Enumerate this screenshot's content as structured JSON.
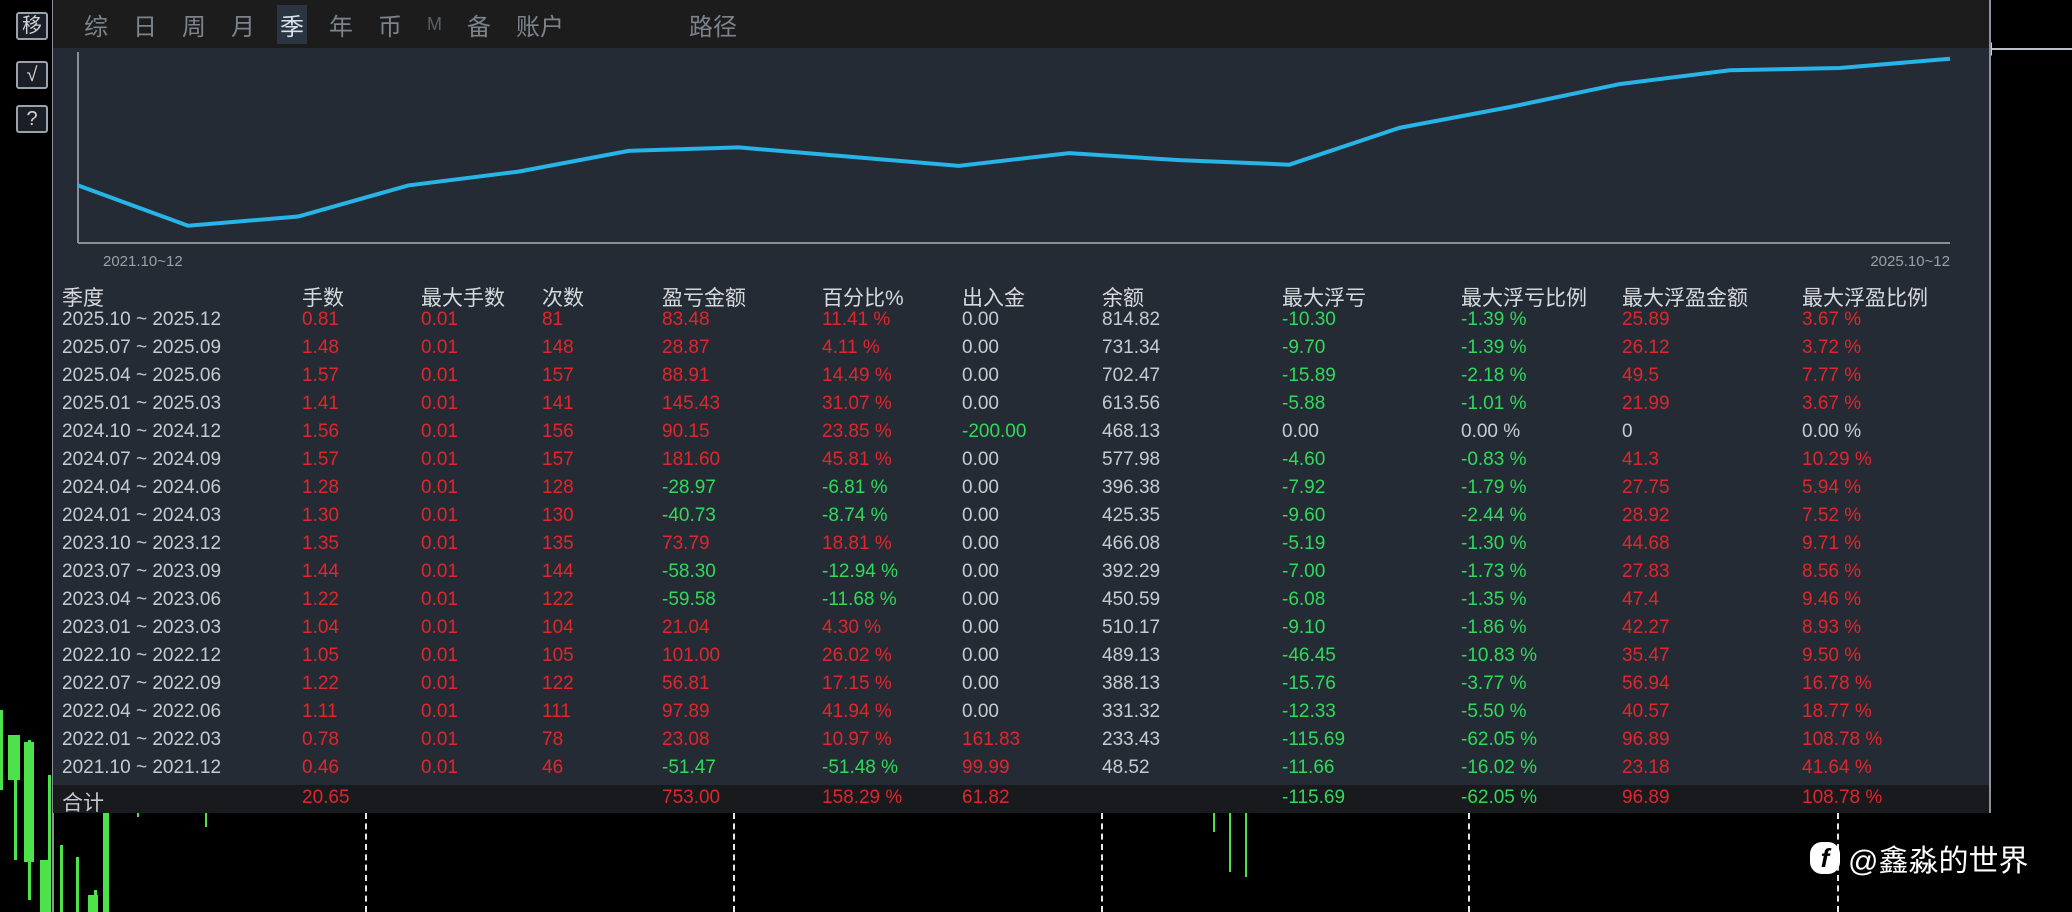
{
  "toolbar": {
    "move": "移",
    "check": "√",
    "help": "?"
  },
  "tabs": [
    {
      "label": "综"
    },
    {
      "label": "日"
    },
    {
      "label": "周"
    },
    {
      "label": "月"
    },
    {
      "label": "季",
      "active": true
    },
    {
      "label": "年"
    },
    {
      "label": "币"
    },
    {
      "label": "M"
    },
    {
      "label": "备"
    },
    {
      "label": "账户"
    },
    {
      "label": "路径"
    }
  ],
  "chart_data": {
    "type": "line",
    "x_start_label": "2021.10~12",
    "x_end_label": "2025.10~12",
    "series": [
      {
        "name": "equity",
        "values": [
          50,
          15,
          23,
          50,
          62,
          80,
          83,
          75,
          67,
          78,
          72,
          68,
          100,
          118,
          138,
          150,
          152,
          160
        ]
      }
    ],
    "colors": {
      "line": "#27b4e8"
    }
  },
  "table": {
    "headers": [
      "季度",
      "手数",
      "最大手数",
      "次数",
      "盈亏金额",
      "百分比%",
      "出入金",
      "余额",
      "最大浮亏",
      "最大浮亏比例",
      "最大浮盈金额",
      "最大浮盈比例"
    ],
    "rows": [
      [
        "2025.10 ~ 2025.12",
        "0.81",
        "0.01",
        "81",
        "83.48",
        "11.41 %",
        "0.00",
        "814.82",
        "-10.30",
        "-1.39 %",
        "25.89",
        "3.67 %"
      ],
      [
        "2025.07 ~ 2025.09",
        "1.48",
        "0.01",
        "148",
        "28.87",
        "4.11 %",
        "0.00",
        "731.34",
        "-9.70",
        "-1.39 %",
        "26.12",
        "3.72 %"
      ],
      [
        "2025.04 ~ 2025.06",
        "1.57",
        "0.01",
        "157",
        "88.91",
        "14.49 %",
        "0.00",
        "702.47",
        "-15.89",
        "-2.18 %",
        "49.5",
        "7.77 %"
      ],
      [
        "2025.01 ~ 2025.03",
        "1.41",
        "0.01",
        "141",
        "145.43",
        "31.07 %",
        "0.00",
        "613.56",
        "-5.88",
        "-1.01 %",
        "21.99",
        "3.67 %"
      ],
      [
        "2024.10 ~ 2024.12",
        "1.56",
        "0.01",
        "156",
        "90.15",
        "23.85 %",
        "-200.00",
        "468.13",
        "0.00",
        "0.00 %",
        "0",
        "0.00 %"
      ],
      [
        "2024.07 ~ 2024.09",
        "1.57",
        "0.01",
        "157",
        "181.60",
        "45.81 %",
        "0.00",
        "577.98",
        "-4.60",
        "-0.83 %",
        "41.3",
        "10.29 %"
      ],
      [
        "2024.04 ~ 2024.06",
        "1.28",
        "0.01",
        "128",
        "-28.97",
        "-6.81 %",
        "0.00",
        "396.38",
        "-7.92",
        "-1.79 %",
        "27.75",
        "5.94 %"
      ],
      [
        "2024.01 ~ 2024.03",
        "1.30",
        "0.01",
        "130",
        "-40.73",
        "-8.74 %",
        "0.00",
        "425.35",
        "-9.60",
        "-2.44 %",
        "28.92",
        "7.52 %"
      ],
      [
        "2023.10 ~ 2023.12",
        "1.35",
        "0.01",
        "135",
        "73.79",
        "18.81 %",
        "0.00",
        "466.08",
        "-5.19",
        "-1.30 %",
        "44.68",
        "9.71 %"
      ],
      [
        "2023.07 ~ 2023.09",
        "1.44",
        "0.01",
        "144",
        "-58.30",
        "-12.94 %",
        "0.00",
        "392.29",
        "-7.00",
        "-1.73 %",
        "27.83",
        "8.56 %"
      ],
      [
        "2023.04 ~ 2023.06",
        "1.22",
        "0.01",
        "122",
        "-59.58",
        "-11.68 %",
        "0.00",
        "450.59",
        "-6.08",
        "-1.35 %",
        "47.4",
        "9.46 %"
      ],
      [
        "2023.01 ~ 2023.03",
        "1.04",
        "0.01",
        "104",
        "21.04",
        "4.30 %",
        "0.00",
        "510.17",
        "-9.10",
        "-1.86 %",
        "42.27",
        "8.93 %"
      ],
      [
        "2022.10 ~ 2022.12",
        "1.05",
        "0.01",
        "105",
        "101.00",
        "26.02 %",
        "0.00",
        "489.13",
        "-46.45",
        "-10.83 %",
        "35.47",
        "9.50 %"
      ],
      [
        "2022.07 ~ 2022.09",
        "1.22",
        "0.01",
        "122",
        "56.81",
        "17.15 %",
        "0.00",
        "388.13",
        "-15.76",
        "-3.77 %",
        "56.94",
        "16.78 %"
      ],
      [
        "2022.04 ~ 2022.06",
        "1.11",
        "0.01",
        "111",
        "97.89",
        "41.94 %",
        "0.00",
        "331.32",
        "-12.33",
        "-5.50 %",
        "40.57",
        "18.77 %"
      ],
      [
        "2022.01 ~ 2022.03",
        "0.78",
        "0.01",
        "78",
        "23.08",
        "10.97 %",
        "161.83",
        "233.43",
        "-115.69",
        "-62.05 %",
        "96.89",
        "108.78 %"
      ],
      [
        "2021.10 ~ 2021.12",
        "0.46",
        "0.01",
        "46",
        "-51.47",
        "-51.48 %",
        "99.99",
        "48.52",
        "-11.66",
        "-16.02 %",
        "23.18",
        "41.64 %"
      ]
    ],
    "total": [
      "合计",
      "20.65",
      "",
      "",
      "753.00",
      "158.29 %",
      "61.82",
      "",
      "-115.69",
      "-62.05 %",
      "96.89",
      "108.78 %"
    ]
  },
  "watermark": "@鑫淼的世界",
  "colors": {
    "profit": "#e0262b",
    "loss": "#2fd95a",
    "neutral": "#c6cbd3"
  }
}
